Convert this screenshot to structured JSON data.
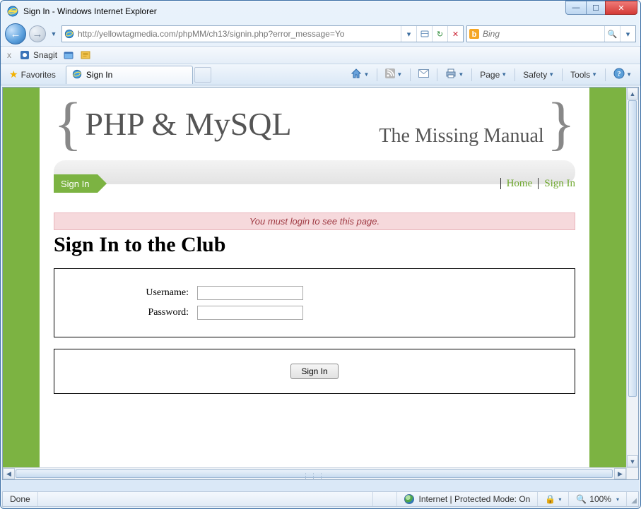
{
  "window": {
    "title": "Sign In - Windows Internet Explorer"
  },
  "address": {
    "url": "http://yellowtagmedia.com/phpMM/ch13/signin.php?error_message=Yo"
  },
  "search": {
    "placeholder": "Bing"
  },
  "snagit": {
    "label": "Snagit"
  },
  "favorites": {
    "label": "Favorites"
  },
  "tab": {
    "title": "Sign In"
  },
  "commands": {
    "page": "Page",
    "safety": "Safety",
    "tools": "Tools"
  },
  "content": {
    "logo_main": "PHP & MySQL",
    "logo_sub": "The Missing Manual",
    "breadcrumb": "Sign In",
    "nav": {
      "home": "Home",
      "signin": "Sign In"
    },
    "alert": "You must login to see this page.",
    "heading": "Sign In to the Club",
    "labels": {
      "username": "Username:",
      "password": "Password:"
    },
    "values": {
      "username": "",
      "password": ""
    },
    "submit": "Sign In"
  },
  "status": {
    "done": "Done",
    "zone": "Internet | Protected Mode: On",
    "zoom": "100%"
  }
}
